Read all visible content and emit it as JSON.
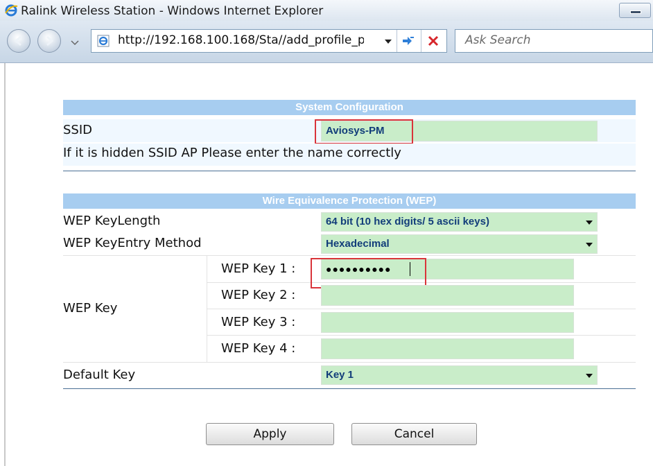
{
  "window": {
    "title": "Ralink Wireless Station - Windows Internet Explorer"
  },
  "nav": {
    "url": "http://192.168.100.168/Sta//add_profile_p",
    "search_placeholder": "Ask Search"
  },
  "system_config": {
    "header": "System Configuration",
    "ssid_label": "SSID",
    "ssid_value": "Aviosys-PM",
    "hint": "If it is hidden SSID AP Please enter the name correctly"
  },
  "wep": {
    "header": "Wire Equivalence Protection (WEP)",
    "key_length_label": "WEP KeyLength",
    "key_length_value": "64 bit (10 hex digits/ 5 ascii keys)",
    "entry_method_label": "WEP KeyEntry Method",
    "entry_method_value": "Hexadecimal",
    "wep_key_label": "WEP Key",
    "keys": [
      {
        "label": "WEP Key 1 :",
        "value": "●●●●●●●●●●"
      },
      {
        "label": "WEP Key 2 :",
        "value": ""
      },
      {
        "label": "WEP Key 3 :",
        "value": ""
      },
      {
        "label": "WEP Key 4 :",
        "value": ""
      }
    ],
    "default_key_label": "Default Key",
    "default_key_value": "Key 1"
  },
  "buttons": {
    "apply": "Apply",
    "cancel": "Cancel"
  },
  "colors": {
    "section_header": "#a7cdf0",
    "field_bg": "#c9edc9",
    "highlight": "#d9343a"
  }
}
